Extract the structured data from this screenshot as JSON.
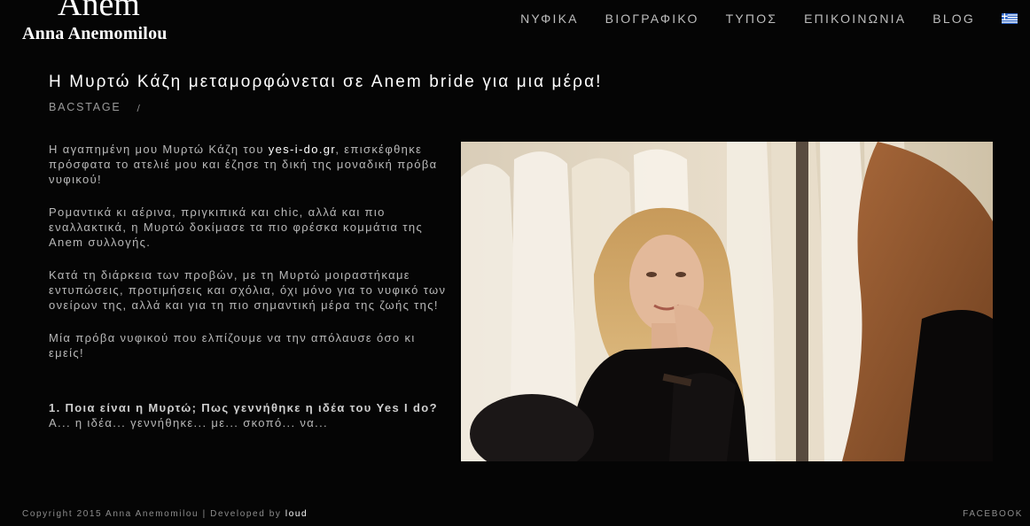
{
  "header": {
    "logo_mark": "Anem",
    "logo_name": "Anna Anemomilou",
    "nav": [
      {
        "label": "ΝΥΦΙΚΑ"
      },
      {
        "label": "ΒΙΟΓΡΑΦΙΚΟ"
      },
      {
        "label": "ΤΥΠΟΣ"
      },
      {
        "label": "ΕΠΙΚΟΙΝΩΝΙΑ"
      },
      {
        "label": "BLOG"
      }
    ],
    "language_icon": "greek-flag-icon"
  },
  "article": {
    "title": "Η Μυρτώ Κάζη μεταμορφώνεται σε Anem bride για μια μέρα!",
    "category": "BACSTAGE",
    "meta_separator": "/",
    "intro_before_link": "Η αγαπημένη μου Μυρτώ Κάζη του ",
    "intro_link": "yes-i-do.gr",
    "intro_after_link": ", επισκέφθηκε πρόσφατα το ατελιέ μου και έζησε τη δική της μοναδική πρόβα νυφικού!",
    "paragraph_2": "Ρομαντικά κι αέρινα, πριγκιπικά και chic, αλλά και πιο εναλλακτικά, η Μυρτώ δοκίμασε τα πιο φρέσκα κομμάτια της Anem συλλογής.",
    "paragraph_3": "Κατά τη διάρκεια των προβών, με τη Μυρτώ μοιραστήκαμε εντυπώσεις, προτιμήσεις και σχόλια, όχι μόνο για το νυφικό των ονείρων της, αλλά και για τη πιο σημαντική μέρα της ζωής της!",
    "paragraph_4": "Μία πρόβα νυφικού που ελπίζουμε να την απόλαυσε όσο κι εμείς!",
    "question_1": "1. Ποια είναι η Μυρτώ; Πως γεννήθηκε η ιδέα του Yes I do?",
    "answer_1_partial": "Α... η ιδέα... γεννήθηκε... με... σκοπό... να..."
  },
  "footer": {
    "copyright": "Copyright 2015 Anna Anemomilou | Developed by ",
    "developer": "loud",
    "social": "FACEBOOK"
  },
  "colors": {
    "background": "#050505",
    "text": "#b8b8b8",
    "heading": "#ffffff",
    "muted": "#8d8d8d"
  }
}
